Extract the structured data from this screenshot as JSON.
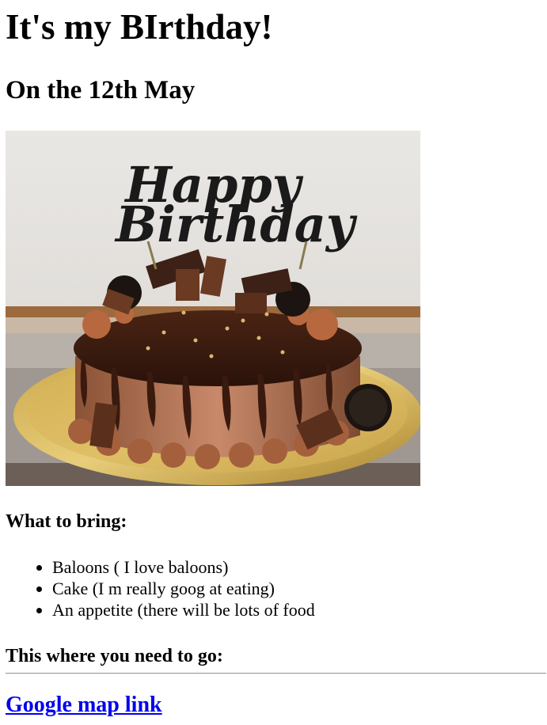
{
  "page": {
    "title": "It's my BIrthday!",
    "subtitle": "On the 12th May"
  },
  "photo": {
    "topper_text": "Happy Birthday"
  },
  "bring": {
    "heading": "What to bring:",
    "items": [
      "Baloons ( I love baloons)",
      "Cake (I m really goog at eating)",
      "An appetite (there will be lots of food"
    ]
  },
  "directions": {
    "heading": "This where you need to go:",
    "link_label": "Google map link"
  },
  "colors": {
    "link": "#0000ee",
    "text": "#000000"
  }
}
